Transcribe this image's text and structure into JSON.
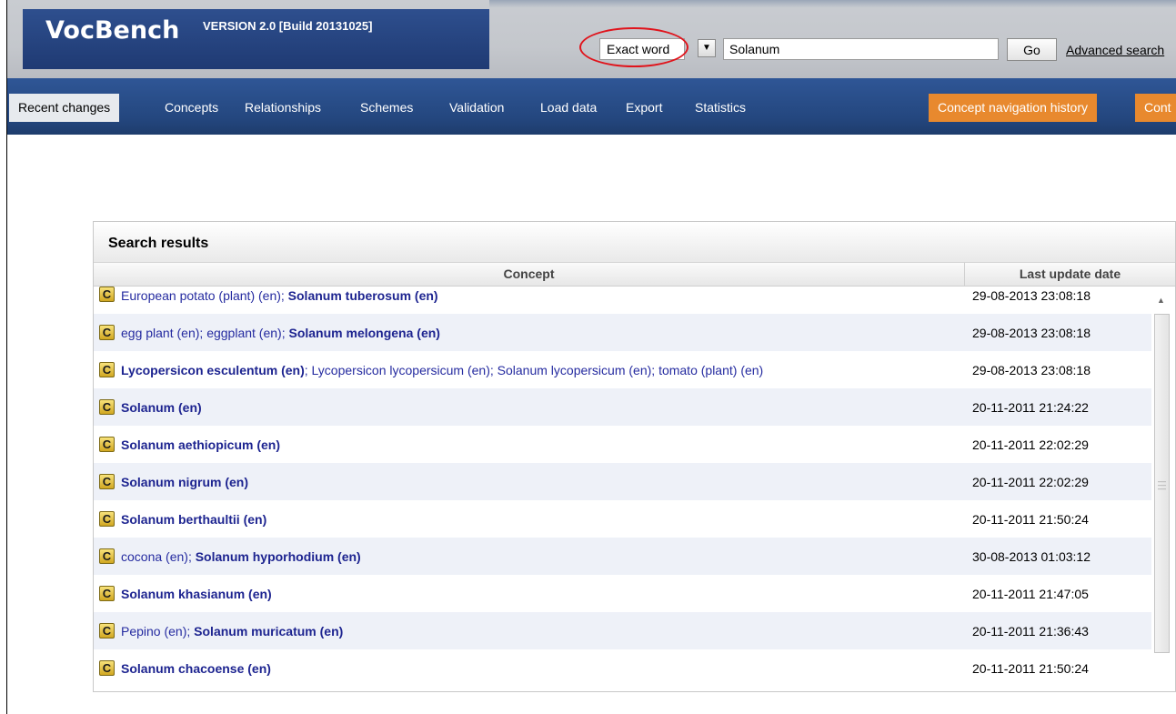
{
  "header": {
    "app_title": "VocBench",
    "version": "VERSION 2.0 [Build 20131025]",
    "search_mode": "Exact word",
    "search_value": "Solanum",
    "go_label": "Go",
    "advanced_search_label": "Advanced search",
    "dropdown_glyph": "▼"
  },
  "nav": {
    "items": [
      "Recent changes",
      "Concepts",
      "Relationships",
      "Schemes",
      "Validation",
      "Load data",
      "Export",
      "Statistics"
    ],
    "active_item": "Recent changes",
    "right_buttons": [
      "Concept navigation history",
      "Cont"
    ]
  },
  "results": {
    "title": "Search results",
    "columns": [
      "Concept",
      "Last update date"
    ],
    "badge": "C",
    "separator": "; ",
    "rows": [
      {
        "labels": [
          {
            "text": "European potato (plant) (en)",
            "pref": false
          },
          {
            "text": "Solanum tuberosum (en)",
            "pref": true
          }
        ],
        "date": "29-08-2013 23:08:18"
      },
      {
        "labels": [
          {
            "text": "egg plant (en)",
            "pref": false
          },
          {
            "text": "eggplant (en)",
            "pref": false
          },
          {
            "text": "Solanum melongena (en)",
            "pref": true
          }
        ],
        "date": "29-08-2013 23:08:18"
      },
      {
        "labels": [
          {
            "text": "Lycopersicon esculentum (en)",
            "pref": true
          },
          {
            "text": "Lycopersicon lycopersicum (en)",
            "pref": false
          },
          {
            "text": "Solanum lycopersicum (en)",
            "pref": false
          },
          {
            "text": "tomato (plant) (en)",
            "pref": false
          }
        ],
        "date": "29-08-2013 23:08:18"
      },
      {
        "labels": [
          {
            "text": "Solanum (en)",
            "pref": true
          }
        ],
        "date": "20-11-2011 21:24:22"
      },
      {
        "labels": [
          {
            "text": "Solanum aethiopicum (en)",
            "pref": true
          }
        ],
        "date": "20-11-2011 22:02:29"
      },
      {
        "labels": [
          {
            "text": "Solanum nigrum (en)",
            "pref": true
          }
        ],
        "date": "20-11-2011 22:02:29"
      },
      {
        "labels": [
          {
            "text": "Solanum berthaultii (en)",
            "pref": true
          }
        ],
        "date": "20-11-2011 21:50:24"
      },
      {
        "labels": [
          {
            "text": "cocona (en)",
            "pref": false
          },
          {
            "text": "Solanum hyporhodium (en)",
            "pref": true
          }
        ],
        "date": "30-08-2013 01:03:12"
      },
      {
        "labels": [
          {
            "text": "Solanum khasianum (en)",
            "pref": true
          }
        ],
        "date": "20-11-2011 21:47:05"
      },
      {
        "labels": [
          {
            "text": "Pepino (en)",
            "pref": false
          },
          {
            "text": "Solanum muricatum (en)",
            "pref": true
          }
        ],
        "date": "20-11-2011 21:36:43"
      },
      {
        "labels": [
          {
            "text": "Solanum chacoense (en)",
            "pref": true
          }
        ],
        "date": "20-11-2011 21:50:24"
      }
    ]
  },
  "colors": {
    "header_blue": "#24477f",
    "accent_orange": "#e8892e",
    "link_blue": "#252ba0",
    "highlight_red": "#e0141c"
  }
}
